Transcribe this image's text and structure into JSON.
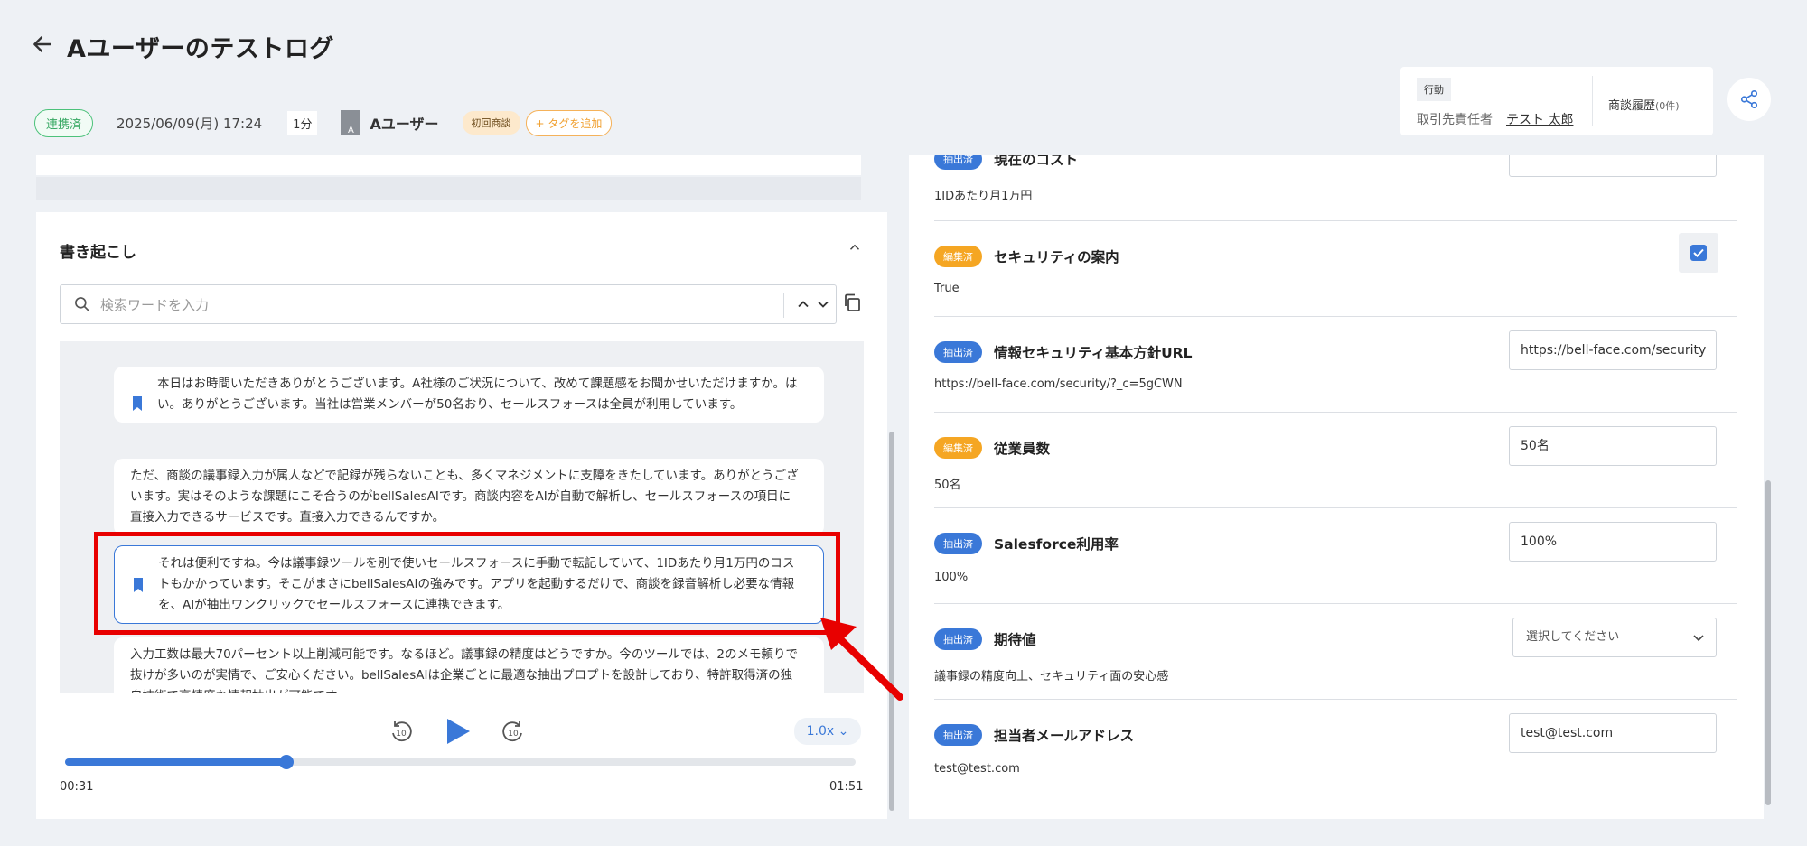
{
  "header": {
    "title": "Aユーザーのテストログ",
    "status_badge": "連携済",
    "date": "2025/06/09(月) 17:24",
    "duration": "1分",
    "avatar_letter": "A",
    "user": "Aユーザー",
    "tag": "初回商談",
    "add_tag": "+ タグを追加"
  },
  "action_card": {
    "label": "行動",
    "role": "取引先責任者",
    "name": "テスト 太郎",
    "history": "商談履歴",
    "history_count": "(0件)"
  },
  "transcript": {
    "title": "書き起こし",
    "search_placeholder": "検索ワードを入力",
    "messages": [
      {
        "text": "本日はお時間いただきありがとうございます。A社様のご状況について、改めて課題感をお聞かせいただけますか。はい。ありがとうございます。当社は営業メンバーが50名おり、セールスフォースは全員が利用しています。",
        "bookmarked": true
      },
      {
        "text": "ただ、商談の議事録入力が属人などで記録が残らないことも、多くマネジメントに支障をきたしています。ありがとうございます。実はそのような課題にこそ合うのがbellSalesAIです。商談内容をAIが自動で解析し、セールスフォースの項目に直接入力できるサービスです。直接入力できるんですか。",
        "bookmarked": false
      },
      {
        "text": "それは便利ですね。今は議事録ツールを別で使いセールスフォースに手動で転記していて、1IDあたり月1万円のコストもかかっています。そこがまさにbellSalesAIの強みです。アプリを起動するだけで、商談を録音解析し必要な情報を、AIが抽出ワンクリックでセールスフォースに連携できます。",
        "bookmarked": true
      },
      {
        "text": "入力工数は最大70パーセント以上削減可能です。なるほど。議事録の精度はどうですか。今のツールでは、2のメモ頼りで抜けが多いのが実情で、ご安心ください。bellSalesAIは企業ごとに最適な抽出プロプトを設計しており、特許取得済の独自技術で高精度な情報抽出が可能です。",
        "bookmarked": false
      }
    ]
  },
  "player": {
    "speed": "1.0x ⌄",
    "current_time": "00:31",
    "total_time": "01:51",
    "progress": 0.28
  },
  "fields": [
    {
      "badge": "抽出済",
      "badge_type": "extract",
      "label": "現在のコスト",
      "value": "1IDあたり月1万円",
      "input": "",
      "control": "input"
    },
    {
      "badge": "編集済",
      "badge_type": "edit",
      "label": "セキュリティの案内",
      "value": "True",
      "control": "checkbox",
      "checked": true
    },
    {
      "badge": "抽出済",
      "badge_type": "extract",
      "label": "情報セキュリティ基本方針URL",
      "value": "https://bell-face.com/security/?_c=5gCWN",
      "input": "https://bell-face.com/security",
      "control": "input"
    },
    {
      "badge": "編集済",
      "badge_type": "edit",
      "label": "従業員数",
      "value": "50名",
      "input": "50名",
      "control": "input"
    },
    {
      "badge": "抽出済",
      "badge_type": "extract",
      "label": "Salesforce利用率",
      "value": "100%",
      "input": "100%",
      "control": "input"
    },
    {
      "badge": "抽出済",
      "badge_type": "extract",
      "label": "期待値",
      "value": "議事録の精度向上、セキュリティ面の安心感",
      "input": "選択してください",
      "control": "select"
    },
    {
      "badge": "抽出済",
      "badge_type": "extract",
      "label": "担当者メールアドレス",
      "value": "test@test.com",
      "input": "test@test.com",
      "control": "input"
    }
  ],
  "colors": {
    "accent": "#3a78d8",
    "edit_badge": "#f5a623",
    "highlight": "#e80000",
    "linked": "#36a862"
  }
}
